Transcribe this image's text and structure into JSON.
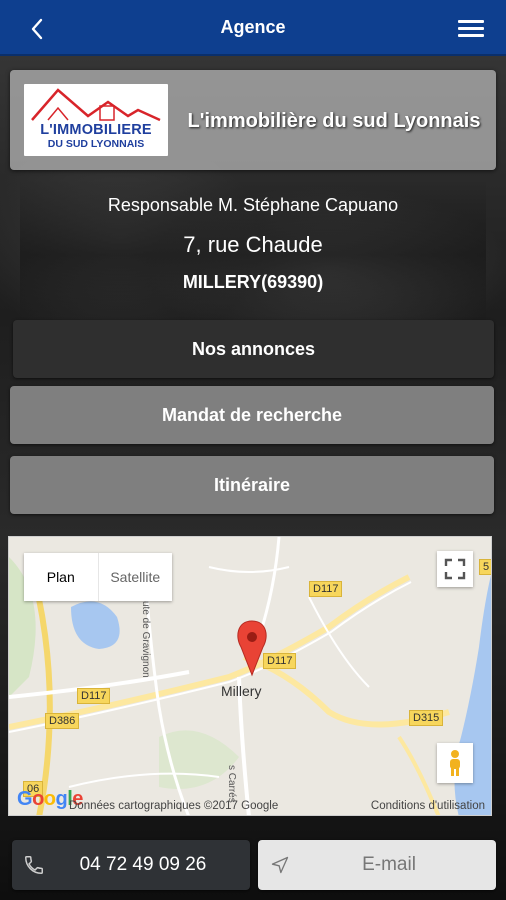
{
  "header": {
    "title": "Agence",
    "back_icon": "chevron-left-icon",
    "menu_icon": "hamburger-menu-icon",
    "background": "#0e3f8f"
  },
  "agency": {
    "logo_line1": "L'IMMOBILIERE",
    "logo_line2": "DU SUD LYONNAIS",
    "name": "L'immobilière du sud Lyonnais"
  },
  "contact": {
    "responsable": "Responsable M. Stéphane Capuano",
    "street": "7, rue Chaude",
    "city": "MILLERY(69390)"
  },
  "buttons": {
    "annonces": "Nos annonces",
    "mandat": "Mandat de recherche",
    "itineraire": "Itinéraire"
  },
  "map": {
    "toggle_plan": "Plan",
    "toggle_satellite": "Satellite",
    "place": "Millery",
    "roads": [
      "D117",
      "D117",
      "D117",
      "D386",
      "D315",
      "5",
      "06"
    ],
    "street_name": "ute de Gravignon",
    "street_name2": "s Carrés",
    "attribution": "Données cartographiques ©2017 Google",
    "terms": "Conditions d'utilisation",
    "google_letters": [
      "G",
      "o",
      "o",
      "g",
      "l",
      "e"
    ]
  },
  "actions": {
    "phone": "04 72 49 09 26",
    "email": "E-mail"
  }
}
